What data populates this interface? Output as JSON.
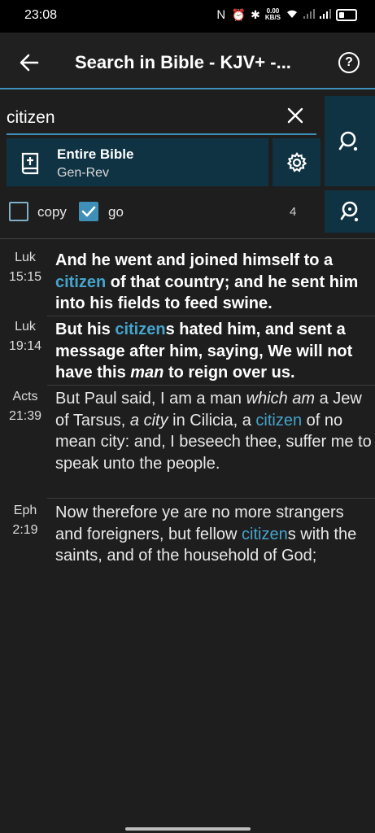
{
  "status": {
    "time": "23:08",
    "net_speed_value": "0.00",
    "net_speed_unit": "KB/S",
    "icons": [
      "nfc-icon",
      "alarm-icon",
      "bluetooth-icon",
      "wifi-icon",
      "signal-icon",
      "signal-icon",
      "battery-icon"
    ]
  },
  "appbar": {
    "title": "Search in Bible - KJV+ -...",
    "help_glyph": "?"
  },
  "search": {
    "query": "citizen",
    "scope_title": "Entire Bible",
    "scope_range": "Gen-Rev",
    "copy_label": "copy",
    "copy_checked": false,
    "go_label": "go",
    "go_checked": true,
    "result_count": "4"
  },
  "colors": {
    "accent": "#3e90b8",
    "highlight": "#45a4cc",
    "button_bg": "#0f3343",
    "background": "#1e1e1e"
  },
  "results": [
    {
      "book": "Luk",
      "chapter_verse": "15:15",
      "t1": "And he went and joined himself to a ",
      "h1": "citizen",
      "t2": " of that country; and he sent him into his fields to feed swine."
    },
    {
      "book": "Luk",
      "chapter_verse": "19:14",
      "t1": "But his ",
      "h1": "citizen",
      "t2": "s hated him, and sent a message after him, saying, We will not have this ",
      "i1": "man",
      "t3": " to reign over us."
    },
    {
      "book": "Acts",
      "chapter_verse": "21:39",
      "t1": "But Paul said, I am a man ",
      "i1": "which am",
      "t2": " a Jew of Tarsus, ",
      "i2": "a city",
      "t3": " in Cilicia, a ",
      "h1": "citizen",
      "t4": " of no mean city: and, I beseech thee, suffer me to speak unto the people."
    },
    {
      "book": "Eph",
      "chapter_verse": "2:19",
      "t1": "Now therefore ye are no more strangers and foreigners, but fellow ",
      "h1": "citizen",
      "t2": "s with the saints, and of the household of God;"
    }
  ]
}
